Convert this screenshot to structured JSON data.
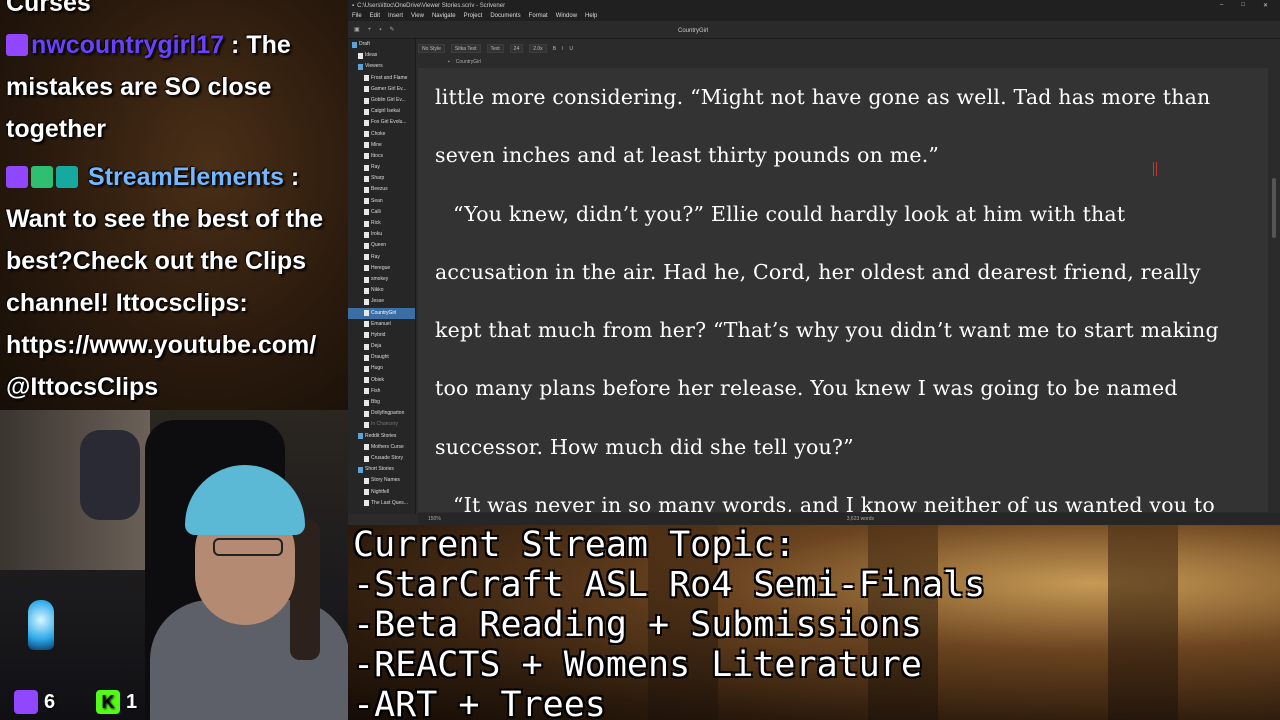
{
  "chat": {
    "top_cut_text": "Curses",
    "msg1_user": "nwcountrygirl17",
    "msg1_sep": " : The",
    "msg1_line2": "mistakes are SO close",
    "msg1_line3": "together",
    "msg2_user": "StreamElements",
    "msg2_sep": " :",
    "msg2_lines": [
      "Want to see the best of the",
      "best?Check out the Clips",
      "channel! Ittocsclips:",
      "https://www.youtube.com/",
      "@IttocsClips"
    ]
  },
  "counters": {
    "twitch_count": "6",
    "kick_count": "1",
    "kick_letter": "K"
  },
  "window": {
    "title": "C:\\Users\\ittoc\\OneDrive\\Viewer Stories.scriv - Scrivener",
    "menu": [
      "File",
      "Edit",
      "Insert",
      "View",
      "Navigate",
      "Project",
      "Documents",
      "Format",
      "Window",
      "Help"
    ],
    "doc_title": "CountryGirl",
    "format_style": "No Style",
    "format_font": "Sitka Text",
    "format_face": "Text",
    "format_size": "24",
    "format_spacing": "2.0x",
    "header_doc": "CountryGirl",
    "zoom": "150%",
    "word_count": "3,623 words"
  },
  "binder": [
    {
      "label": "Draft",
      "folder": true,
      "indent": 0
    },
    {
      "label": "Ideas",
      "folder": false,
      "indent": 1
    },
    {
      "label": "Viewers",
      "folder": true,
      "indent": 1
    },
    {
      "label": "Frost and Flame",
      "folder": false,
      "indent": 2
    },
    {
      "label": "Gamer Girl Ev...",
      "folder": false,
      "indent": 2
    },
    {
      "label": "Goblin Girl Ev...",
      "folder": false,
      "indent": 2
    },
    {
      "label": "Catgirl Isekai",
      "folder": false,
      "indent": 2
    },
    {
      "label": "Fox Girl Evolu...",
      "folder": false,
      "indent": 2
    },
    {
      "label": "Choke",
      "folder": false,
      "indent": 2
    },
    {
      "label": "Mine",
      "folder": false,
      "indent": 2
    },
    {
      "label": "Ittocs",
      "folder": false,
      "indent": 2
    },
    {
      "label": "Ray",
      "folder": false,
      "indent": 2
    },
    {
      "label": "Sharp",
      "folder": false,
      "indent": 2
    },
    {
      "label": "Beezus",
      "folder": false,
      "indent": 2
    },
    {
      "label": "Sean",
      "folder": false,
      "indent": 2
    },
    {
      "label": "Calli",
      "folder": false,
      "indent": 2
    },
    {
      "label": "Rick",
      "folder": false,
      "indent": 2
    },
    {
      "label": "Iroku",
      "folder": false,
      "indent": 2
    },
    {
      "label": "Queen",
      "folder": false,
      "indent": 2
    },
    {
      "label": "Ray",
      "folder": false,
      "indent": 2
    },
    {
      "label": "Heregue",
      "folder": false,
      "indent": 2
    },
    {
      "label": "smokey",
      "folder": false,
      "indent": 2
    },
    {
      "label": "Nikko",
      "folder": false,
      "indent": 2
    },
    {
      "label": "Jesse",
      "folder": false,
      "indent": 2
    },
    {
      "label": "CountryGirl",
      "folder": false,
      "indent": 2,
      "selected": true
    },
    {
      "label": "Emanuel",
      "folder": false,
      "indent": 2
    },
    {
      "label": "Hybrid",
      "folder": false,
      "indent": 2
    },
    {
      "label": "Deja",
      "folder": false,
      "indent": 2
    },
    {
      "label": "Draught",
      "folder": false,
      "indent": 2
    },
    {
      "label": "Hugo",
      "folder": false,
      "indent": 2
    },
    {
      "label": "Obiek",
      "folder": false,
      "indent": 2
    },
    {
      "label": "Fish",
      "folder": false,
      "indent": 2
    },
    {
      "label": "Bbg",
      "folder": false,
      "indent": 2
    },
    {
      "label": "Dollyfingparton",
      "folder": false,
      "indent": 2
    },
    {
      "label": "In Chancery",
      "folder": false,
      "indent": 2,
      "dim": true
    },
    {
      "label": "Reddit Stories",
      "folder": true,
      "indent": 1
    },
    {
      "label": "Mothers Curse",
      "folder": false,
      "indent": 2
    },
    {
      "label": "Crusade Story",
      "folder": false,
      "indent": 2
    },
    {
      "label": "Short Stories",
      "folder": true,
      "indent": 1
    },
    {
      "label": "Story Names",
      "folder": false,
      "indent": 2
    },
    {
      "label": "Nightfell",
      "folder": false,
      "indent": 2
    },
    {
      "label": "The Last Ques...",
      "folder": false,
      "indent": 2
    }
  ],
  "editor_lines": [
    {
      "text": "little more considering. “Might not have gone as well. Tad has more than",
      "indent": false
    },
    {
      "text": "seven inches and at least thirty pounds on me.”",
      "indent": false
    },
    {
      "text": "“You knew, didn’t you?” Ellie could hardly look at him with that",
      "indent": true
    },
    {
      "text": "accusation in the air. Had he, Cord, her oldest and dearest friend, really",
      "indent": false
    },
    {
      "text": "kept that much from her? “That’s why you didn’t want me to start making",
      "indent": false
    },
    {
      "text": "too many plans before her release. You knew I was going to be named",
      "indent": false
    },
    {
      "text": "successor. How much did she tell you?”",
      "indent": false
    },
    {
      "text": "“It was never in so many words, and I know neither of us wanted you to",
      "indent": true
    }
  ],
  "topic": {
    "lines": [
      "Current Stream Topic:",
      "-StarCraft ASL Ro4 Semi-Finals",
      "-Beta Reading + Submissions",
      "-REACTS + Womens Literature",
      "-ART + Trees"
    ]
  }
}
